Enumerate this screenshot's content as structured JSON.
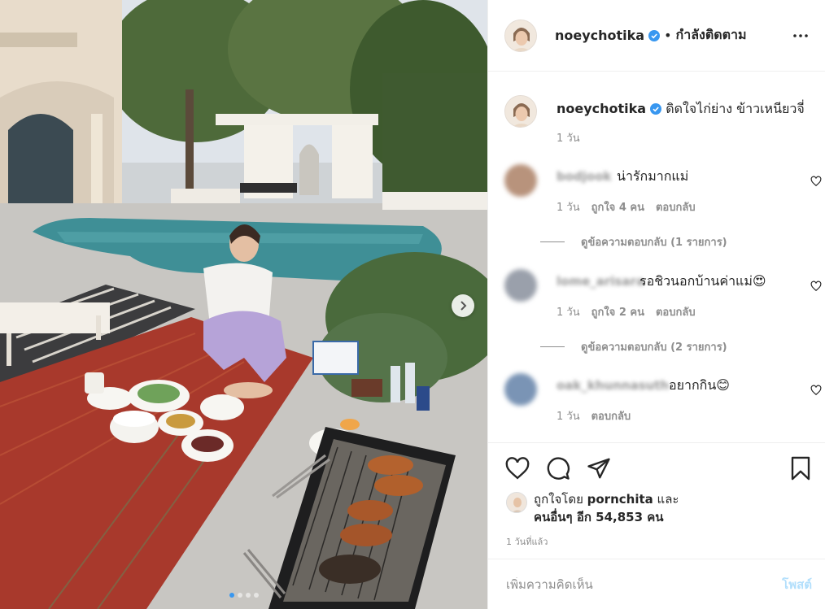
{
  "post": {
    "username": "noeychotika",
    "verified": true,
    "follow_status": "กำลังติดตาม",
    "caption": "ดิดใจไก่ย่าง ข้าวเหนียวจี่",
    "caption_time": "1 วัน"
  },
  "comments": [
    {
      "username": "bodjook",
      "text": "น่ารักมากแม่",
      "time": "1 วัน",
      "likes": "ถูกใจ 4 คน",
      "reply": "ตอบกลับ",
      "view_replies": "ดูข้อความตอบกลับ (1 รายการ)",
      "avatar_color": "#b8937c"
    },
    {
      "username": "lome_arisara",
      "text": "รอชิวนอกบ้านค่าแม่😍",
      "time": "1 วัน",
      "likes": "ถูกใจ 2 คน",
      "reply": "ตอบกลับ",
      "view_replies": "ดูข้อความตอบกลับ (2 รายการ)",
      "avatar_color": "#9aa0ab"
    },
    {
      "username": "oak_khunnasuth",
      "text": "อยากกิน😊",
      "time": "1 วัน",
      "reply": "ตอบกลับ",
      "avatar_color": "#7a94b5"
    }
  ],
  "likes_summary": {
    "line1_prefix": "ถูกใจโดย ",
    "liker": "pornchita",
    "line1_suffix": " และ",
    "line2": "คนอื่นๆ อีก 54,853 คน"
  },
  "posted_time": "1 วันที่แล้ว",
  "comment_input": {
    "placeholder": "เพิ่มความคิดเห็น",
    "post_label": "โพสต์"
  },
  "icons": {
    "header_more": "more-options-icon",
    "verified": "verified-badge-icon",
    "like": "heart-icon",
    "comment": "comment-icon",
    "share": "share-icon",
    "save": "bookmark-icon",
    "carousel_next": "chevron-right-icon"
  },
  "colors": {
    "verified_blue": "#3897f0",
    "border": "#efefef",
    "muted_text": "#8e8e8e",
    "post_button_disabled": "#b2dffc"
  },
  "carousel": {
    "slides": 4,
    "active": 1
  }
}
